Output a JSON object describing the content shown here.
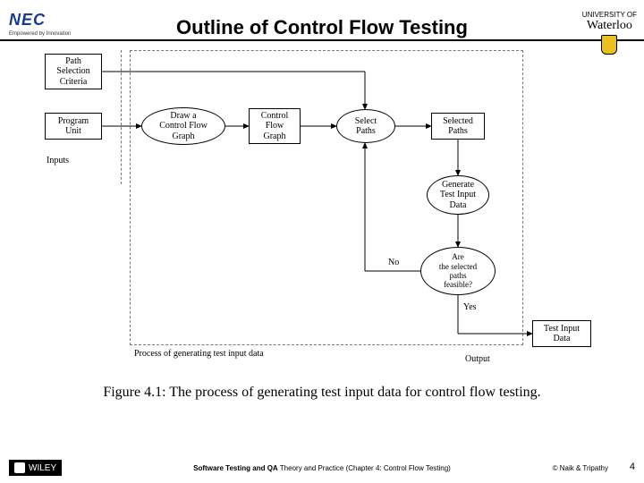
{
  "header": {
    "nec_brand": "NEC",
    "nec_tagline": "Empowered by Innovation",
    "waterloo_prefix": "UNIVERSITY OF",
    "waterloo_name": "Waterloo"
  },
  "title": "Outline of Control Flow Testing",
  "diagram": {
    "n_path_criteria": "Path\nSelection\nCriteria",
    "n_program_unit": "Program\nUnit",
    "n_draw_cfg": "Draw a\nControl Flow\nGraph",
    "n_cfg": "Control\nFlow\nGraph",
    "n_select_paths": "Select\nPaths",
    "n_selected_paths": "Selected\nPaths",
    "n_generate": "Generate\nTest Input\nData",
    "n_feasible": "Are\nthe selected\npaths\nfeasible?",
    "n_test_input": "Test Input\nData",
    "lbl_inputs": "Inputs",
    "lbl_process": "Process of generating test input data",
    "lbl_output": "Output",
    "lbl_no": "No",
    "lbl_yes": "Yes"
  },
  "caption": "Figure 4.1: The process of generating test input data for control flow testing.",
  "footer": {
    "wiley": "WILEY",
    "mid_bold": "Software Testing and QA",
    "mid_rest": " Theory and Practice (Chapter 4: Control Flow Testing)",
    "copyright": "© Naik & Tripathy",
    "slidenum": "4"
  }
}
